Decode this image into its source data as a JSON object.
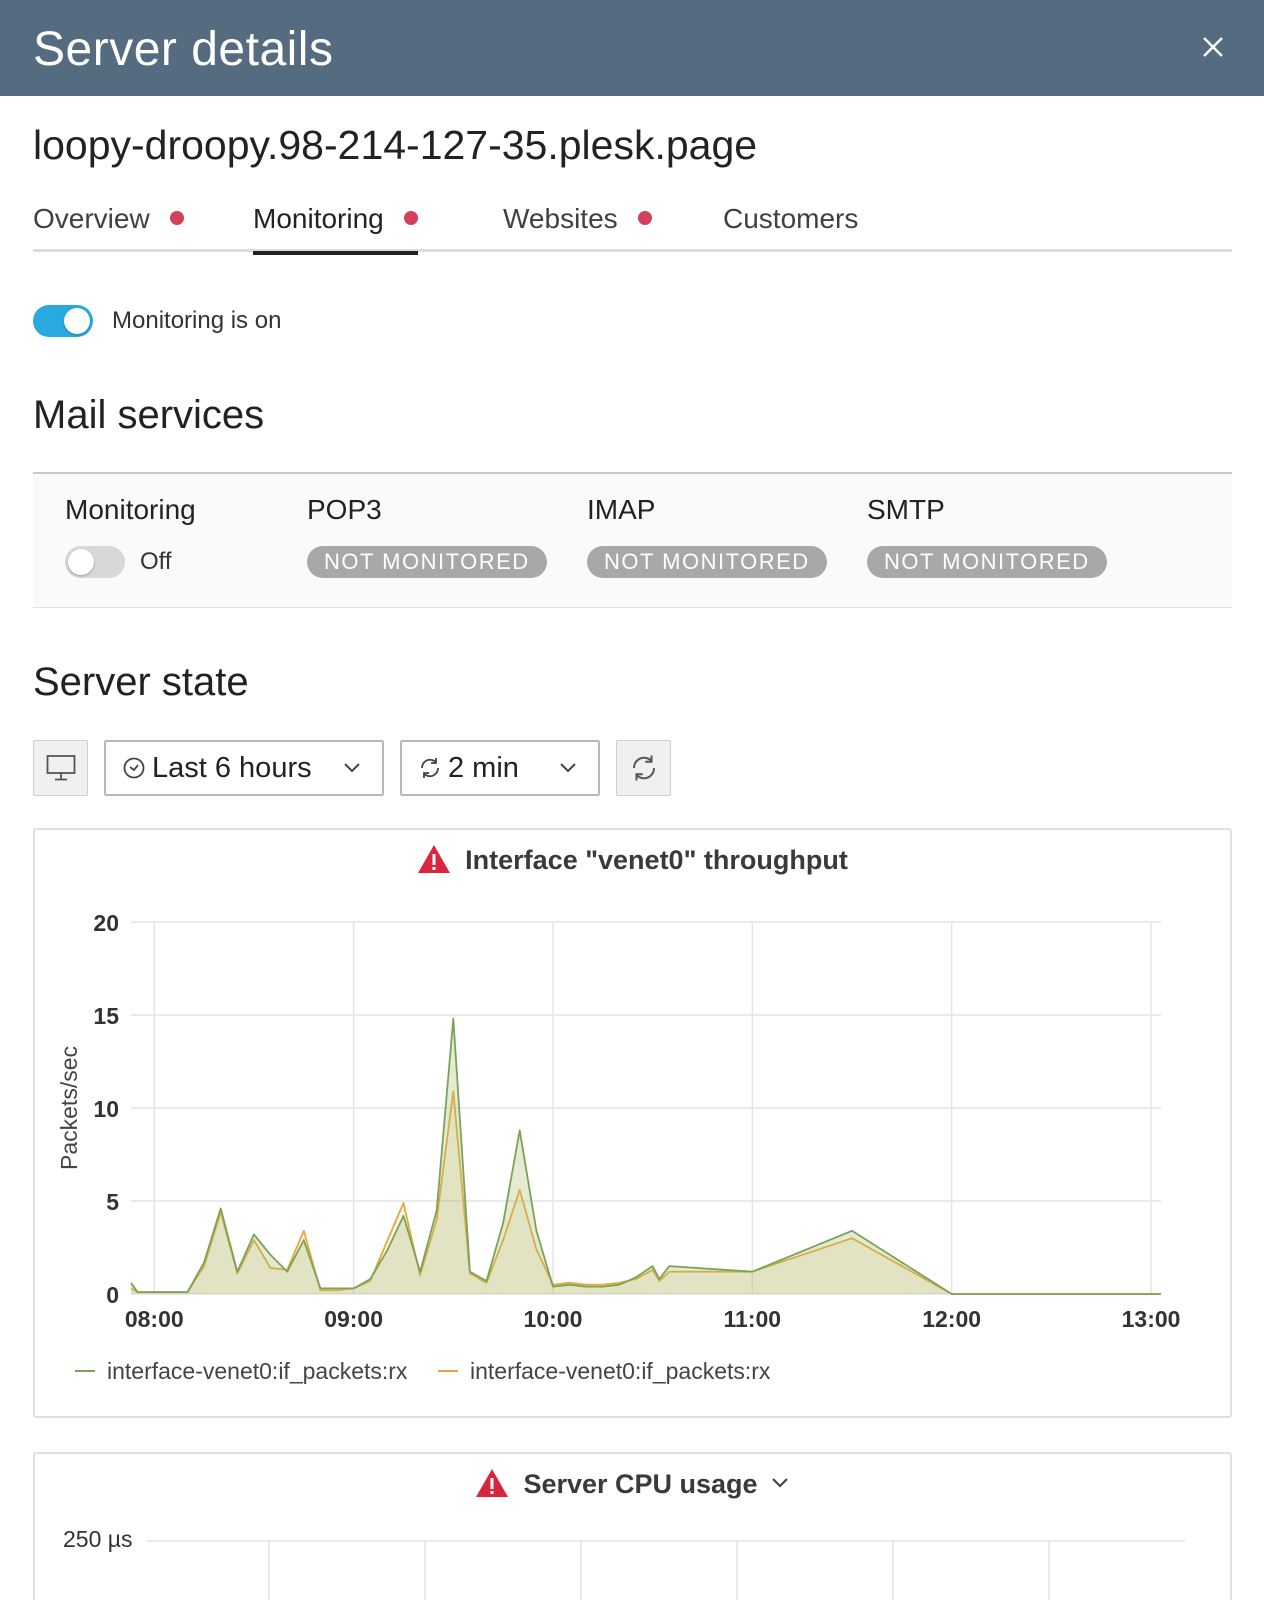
{
  "header": {
    "title": "Server details"
  },
  "server": {
    "name": "loopy-droopy.98-214-127-35.plesk.page"
  },
  "tabs": [
    {
      "label": "Overview",
      "alert": true,
      "active": false
    },
    {
      "label": "Monitoring",
      "alert": true,
      "active": true
    },
    {
      "label": "Websites",
      "alert": true,
      "active": false
    },
    {
      "label": "Customers",
      "alert": false,
      "active": false
    }
  ],
  "monitoring": {
    "enabled": true,
    "label": "Monitoring is on"
  },
  "mail": {
    "title": "Mail services",
    "monitoring_label": "Monitoring",
    "monitoring_state": "Off",
    "services": [
      {
        "name": "POP3",
        "status": "NOT MONITORED"
      },
      {
        "name": "IMAP",
        "status": "NOT MONITORED"
      },
      {
        "name": "SMTP",
        "status": "NOT MONITORED"
      }
    ]
  },
  "server_state": {
    "title": "Server state",
    "range_label": "Last 6 hours",
    "refresh_label": "2 min"
  },
  "colors": {
    "header_bg": "#546b80",
    "toggle_on": "#28aae1",
    "alert_dot": "#d1425a",
    "series_green": "#7aa35a",
    "series_orange": "#e8a93a",
    "warn_red": "#d7263d"
  },
  "chart_data": [
    {
      "type": "area",
      "title": "Interface \"venet0\" throughput",
      "ylabel": "Packets/sec",
      "xlabel": "",
      "ylim": [
        0,
        20
      ],
      "yticks": [
        0,
        5,
        10,
        15,
        20
      ],
      "xticks": [
        "08:00",
        "09:00",
        "10:00",
        "11:00",
        "12:00",
        "13:00"
      ],
      "grid": true,
      "legend_position": "bottom-left",
      "x": [
        "07:53",
        "07:55",
        "08:00",
        "08:05",
        "08:10",
        "08:15",
        "08:20",
        "08:25",
        "08:30",
        "08:35",
        "08:40",
        "08:45",
        "08:50",
        "08:55",
        "09:00",
        "09:05",
        "09:10",
        "09:15",
        "09:20",
        "09:25",
        "09:30",
        "09:35",
        "09:40",
        "09:45",
        "09:50",
        "09:55",
        "10:00",
        "10:05",
        "10:10",
        "10:15",
        "10:20",
        "10:25",
        "10:30",
        "10:32",
        "10:35",
        "11:00",
        "11:30",
        "12:00",
        "12:30",
        "13:00",
        "13:03"
      ],
      "series": [
        {
          "name": "interface-venet0:if_packets:rx",
          "color": "#7aa35a",
          "values": [
            0.6,
            0.1,
            0.1,
            0.1,
            0.1,
            1.7,
            4.6,
            1.2,
            3.2,
            2.1,
            1.2,
            2.9,
            0.3,
            0.3,
            0.3,
            0.8,
            2.3,
            4.2,
            1.2,
            4.5,
            14.8,
            1.2,
            0.7,
            3.8,
            8.8,
            3.4,
            0.4,
            0.5,
            0.4,
            0.4,
            0.5,
            0.9,
            1.5,
            0.8,
            1.5,
            1.2,
            3.4,
            0.0,
            0.0,
            0.0,
            0.0
          ]
        },
        {
          "name": "interface-venet0:if_packets:rx",
          "color": "#e8a93a",
          "values": [
            0.3,
            0.1,
            0.1,
            0.1,
            0.1,
            1.5,
            4.4,
            1.1,
            2.9,
            1.4,
            1.3,
            3.4,
            0.2,
            0.2,
            0.3,
            0.7,
            2.8,
            4.9,
            1.0,
            4.0,
            10.9,
            1.1,
            0.6,
            2.9,
            5.6,
            2.4,
            0.5,
            0.6,
            0.5,
            0.5,
            0.6,
            0.8,
            1.3,
            0.7,
            1.2,
            1.2,
            3.0,
            0.0,
            0.0,
            0.0,
            0.0
          ]
        }
      ]
    },
    {
      "type": "bar",
      "title": "Server CPU usage",
      "ytick_top": "250 µs"
    }
  ]
}
